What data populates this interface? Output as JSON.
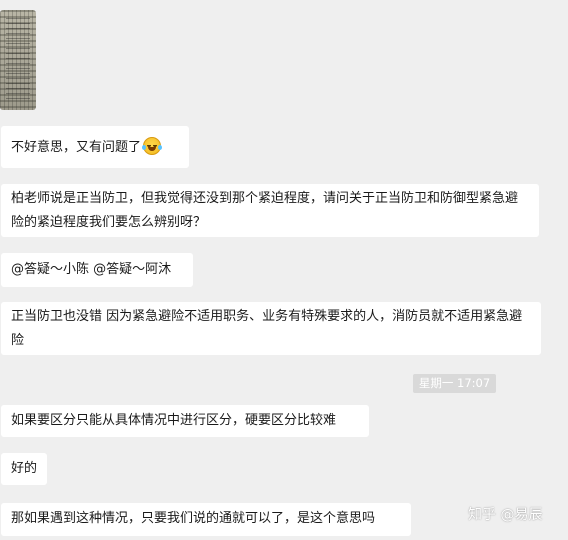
{
  "messages": [
    {
      "text": "不好意思，又有问题了"
    },
    {
      "text": "柏老师说是正当防卫，但我觉得还没到那个紧迫程度，请问关于正当防卫和防御型紧急避险的紧迫程度我们要怎么辨别呀？"
    },
    {
      "text": "@答疑～小陈 @答疑～阿沐"
    },
    {
      "text": "正当防卫也没错 因为紧急避险不适用职务、业务有特殊要求的人，消防员就不适用紧急避险"
    },
    {
      "text": "如果要区分只能从具体情况中进行区分，硬要区分比较难"
    },
    {
      "text": "好的"
    },
    {
      "text": "那如果遇到这种情况，只要我们说的通就可以了，是这个意思吗"
    }
  ],
  "timestamp": "星期一 17:07",
  "watermark": "知乎 @易辰",
  "emoji": "laughing-crying-emoji"
}
